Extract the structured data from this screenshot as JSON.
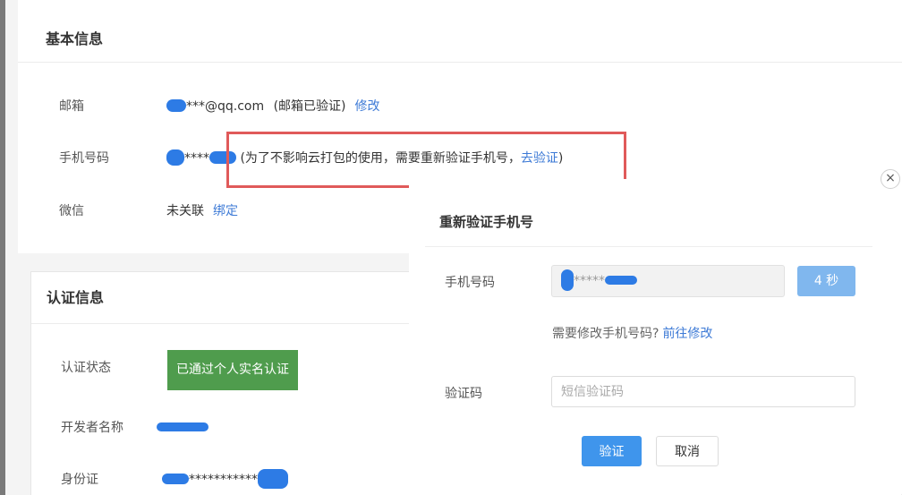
{
  "basic_info": {
    "title": "基本信息",
    "email": {
      "label": "邮箱",
      "value": "***@qq.com",
      "status": "(邮箱已验证)",
      "action": "修改"
    },
    "phone": {
      "label": "手机号码",
      "value": "****",
      "notice_prefix": "(为了不影响云打包的使用，需要重新验证手机号，",
      "notice_link": "去验证",
      "notice_suffix": ")"
    },
    "wechat": {
      "label": "微信",
      "value": "未关联",
      "action": "绑定"
    }
  },
  "auth_info": {
    "title": "认证信息",
    "status": {
      "label": "认证状态",
      "badge": "已通过个人实名认证"
    },
    "developer": {
      "label": "开发者名称"
    },
    "id_card": {
      "label": "身份证",
      "value": "***********"
    }
  },
  "dialog": {
    "title": "重新验证手机号",
    "close_icon": "×",
    "phone_label": "手机号码",
    "phone_value": "*****",
    "countdown": "4 秒",
    "modify_tip": "需要修改手机号码?",
    "modify_link": "前往修改",
    "code_label": "验证码",
    "code_placeholder": "短信验证码",
    "verify_button": "验证",
    "cancel_button": "取消"
  },
  "colors": {
    "link": "#3d7ad6",
    "primary_button": "#3f95ec",
    "countdown_button": "#80b7ee",
    "auth_badge": "#4f9c4d",
    "highlight_border": "#e05a5a",
    "redaction": "#2d7be5"
  }
}
